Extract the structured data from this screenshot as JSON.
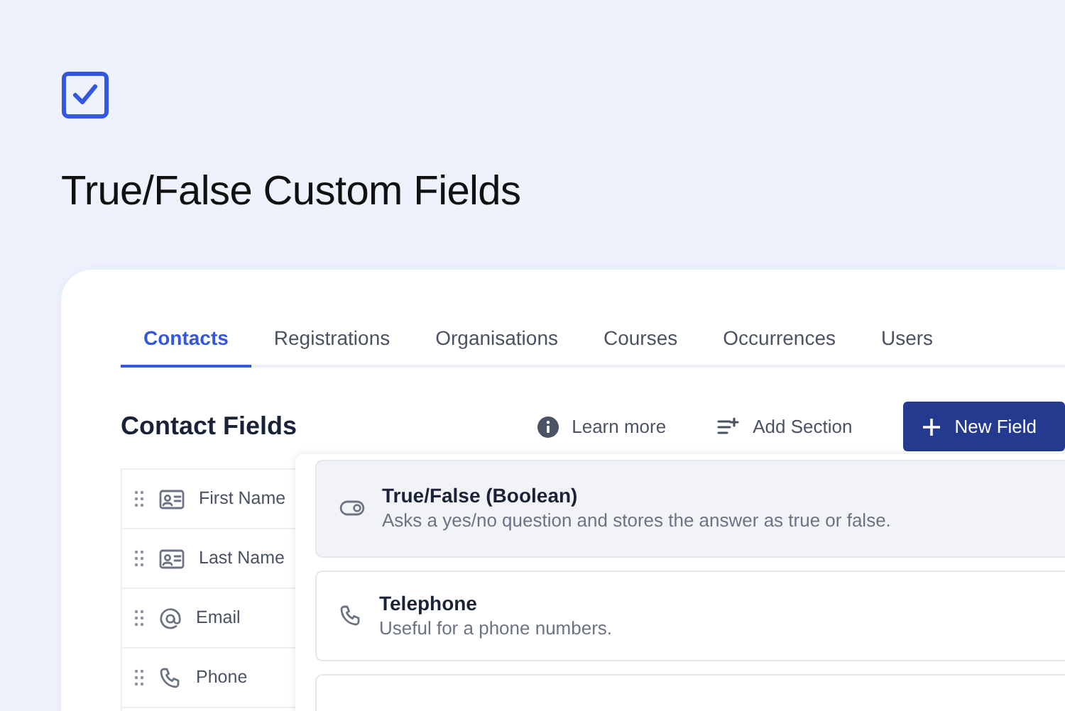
{
  "header": {
    "title": "True/False Custom Fields"
  },
  "tabs": [
    {
      "label": "Contacts",
      "selected": true
    },
    {
      "label": "Registrations",
      "selected": false
    },
    {
      "label": "Organisations",
      "selected": false
    },
    {
      "label": "Courses",
      "selected": false
    },
    {
      "label": "Occurrences",
      "selected": false
    },
    {
      "label": "Users",
      "selected": false
    }
  ],
  "section": {
    "title": "Contact Fields",
    "actions": [
      {
        "label": "Learn more",
        "kind": "info"
      },
      {
        "label": "Add Section",
        "kind": "add-section"
      }
    ],
    "primary_button": "New Field"
  },
  "fields": [
    {
      "label": "First Name",
      "kind": "name"
    },
    {
      "label": "Last Name",
      "kind": "name"
    },
    {
      "label": "Email",
      "kind": "email"
    },
    {
      "label": "Phone",
      "kind": "phone"
    }
  ],
  "menu": {
    "options": [
      {
        "title": "True/False (Boolean)",
        "description": "Asks a yes/no question and stores the answer as true or false.",
        "kind": "boolean",
        "selected": true
      },
      {
        "title": "Telephone",
        "description": "Useful for a phone numbers.",
        "kind": "phone",
        "selected": false
      }
    ]
  }
}
